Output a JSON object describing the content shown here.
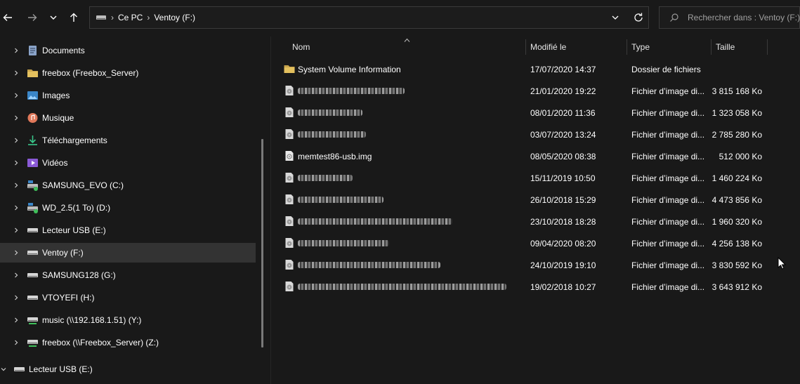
{
  "toolbar": {
    "back_icon": "arrow-left-icon",
    "forward_icon": "arrow-right-icon",
    "recent_icon": "chevron-down-icon",
    "up_icon": "arrow-up-icon"
  },
  "address": {
    "crumbs": [
      "Ce PC",
      "Ventoy (F:)"
    ],
    "separator": "›"
  },
  "search": {
    "placeholder": "Rechercher dans : Ventoy (F:)"
  },
  "sidebar": {
    "items": [
      {
        "label": "Documents",
        "icon": "documents-icon"
      },
      {
        "label": "freebox (Freebox_Server)",
        "icon": "folder-icon"
      },
      {
        "label": "Images",
        "icon": "images-icon"
      },
      {
        "label": "Musique",
        "icon": "music-icon"
      },
      {
        "label": "Téléchargements",
        "icon": "download-icon"
      },
      {
        "label": "Vidéos",
        "icon": "videos-icon"
      },
      {
        "label": "SAMSUNG_EVO (C:)",
        "icon": "system-drive-icon"
      },
      {
        "label": "WD_2.5(1 To) (D:)",
        "icon": "system-drive-icon"
      },
      {
        "label": "Lecteur USB (E:)",
        "icon": "usb-drive-icon"
      },
      {
        "label": "Ventoy (F:)",
        "icon": "usb-drive-icon",
        "selected": true
      },
      {
        "label": "SAMSUNG128 (G:)",
        "icon": "usb-drive-icon"
      },
      {
        "label": "VTOYEFI (H:)",
        "icon": "usb-drive-icon"
      },
      {
        "label": "music (\\\\192.168.1.51) (Y:)",
        "icon": "network-drive-icon"
      },
      {
        "label": "freebox (\\\\Freebox_Server) (Z:)",
        "icon": "network-drive-icon"
      }
    ],
    "root_item": {
      "label": "Lecteur USB (E:)",
      "icon": "usb-drive-icon",
      "expanded": true
    }
  },
  "columns": {
    "name": "Nom",
    "modified": "Modifié le",
    "type": "Type",
    "size": "Taille"
  },
  "files": [
    {
      "name": "System Volume Information",
      "modified": "17/07/2020 14:37",
      "type": "Dossier de fichiers",
      "size": "",
      "icon": "folder-icon",
      "obscured": false
    },
    {
      "name": "",
      "modified": "21/01/2020 19:22",
      "type": "Fichier d’image di...",
      "size": "3 815 168 Ko",
      "icon": "disc-image-icon",
      "obscured": true
    },
    {
      "name": "",
      "modified": "08/01/2020 11:36",
      "type": "Fichier d’image di...",
      "size": "1 323 058 Ko",
      "icon": "disc-image-icon",
      "obscured": true
    },
    {
      "name": "",
      "modified": "03/07/2020 13:24",
      "type": "Fichier d’image di...",
      "size": "2 785 280 Ko",
      "icon": "disc-image-icon",
      "obscured": true
    },
    {
      "name": "memtest86-usb.img",
      "modified": "08/05/2020 08:38",
      "type": "Fichier d’image di...",
      "size": "512 000 Ko",
      "icon": "image-file-icon",
      "obscured": false
    },
    {
      "name": "",
      "modified": "15/11/2019 10:50",
      "type": "Fichier d’image di...",
      "size": "1 460 224 Ko",
      "icon": "disc-image-icon",
      "obscured": true
    },
    {
      "name": "",
      "modified": "26/10/2018 15:29",
      "type": "Fichier d’image di...",
      "size": "4 473 856 Ko",
      "icon": "disc-image-icon",
      "obscured": true
    },
    {
      "name": "",
      "modified": "23/10/2018 18:28",
      "type": "Fichier d’image di...",
      "size": "1 960 320 Ko",
      "icon": "disc-image-icon",
      "obscured": true
    },
    {
      "name": "",
      "modified": "09/04/2020 08:20",
      "type": "Fichier d’image di...",
      "size": "4 256 138 Ko",
      "icon": "disc-image-icon",
      "obscured": true
    },
    {
      "name": "",
      "modified": "24/10/2019 19:10",
      "type": "Fichier d’image di...",
      "size": "3 830 592 Ko",
      "icon": "disc-image-icon",
      "obscured": true
    },
    {
      "name": "",
      "modified": "19/02/2018 10:27",
      "type": "Fichier d’image di...",
      "size": "3 643 912 Ko",
      "icon": "disc-image-icon",
      "obscured": true
    }
  ],
  "colors": {
    "background": "#191919",
    "selected": "#333333",
    "folder": "#c8a44c",
    "text": "#ffffff"
  }
}
